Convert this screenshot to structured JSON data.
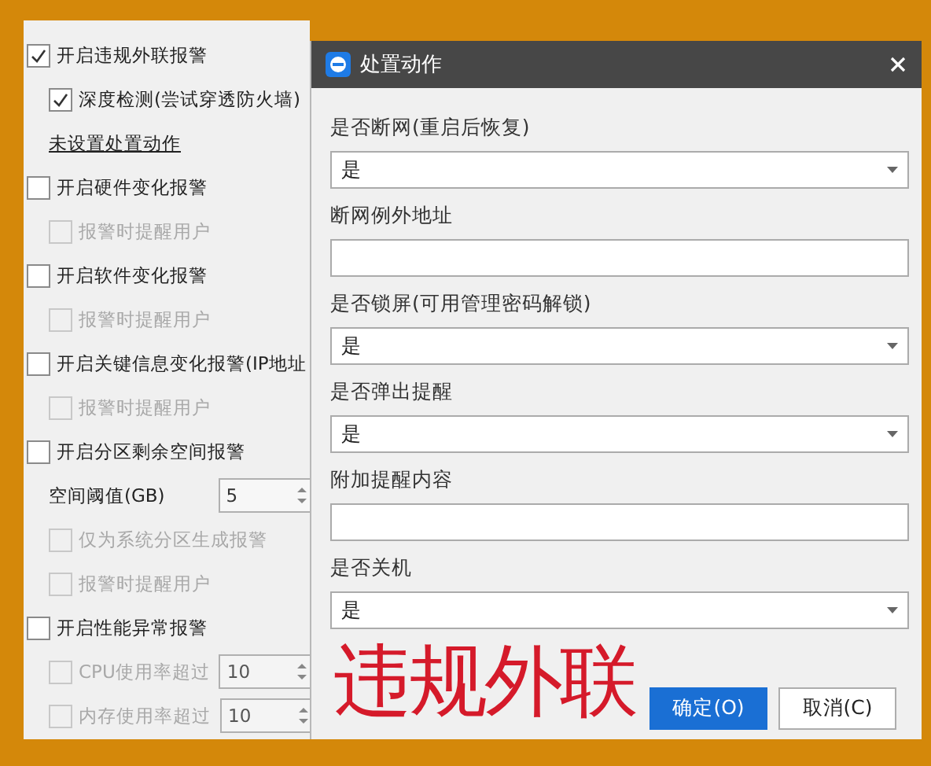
{
  "settings_panel": {
    "items": [
      {
        "kind": "checkbox",
        "label": "开启违规外联报警",
        "checked": true,
        "disabled": false,
        "children": [
          {
            "kind": "checkbox",
            "label": "深度检测(尝试穿透防火墙)",
            "checked": true,
            "disabled": false
          },
          {
            "kind": "link",
            "label": "未设置处置动作"
          }
        ]
      },
      {
        "kind": "checkbox",
        "label": "开启硬件变化报警",
        "checked": false,
        "disabled": false,
        "children": [
          {
            "kind": "checkbox",
            "label": "报警时提醒用户",
            "checked": false,
            "disabled": true
          }
        ]
      },
      {
        "kind": "checkbox",
        "label": "开启软件变化报警",
        "checked": false,
        "disabled": false,
        "children": [
          {
            "kind": "checkbox",
            "label": "报警时提醒用户",
            "checked": false,
            "disabled": true
          }
        ]
      },
      {
        "kind": "checkbox",
        "label": "开启关键信息变化报警(IP地址",
        "checked": false,
        "disabled": false,
        "children": [
          {
            "kind": "checkbox",
            "label": "报警时提醒用户",
            "checked": false,
            "disabled": true
          }
        ]
      },
      {
        "kind": "checkbox",
        "label": "开启分区剩余空间报警",
        "checked": false,
        "disabled": false,
        "children": [
          {
            "kind": "number",
            "label": "空间阈值(GB)",
            "value": "5",
            "disabled": false
          },
          {
            "kind": "checkbox",
            "label": "仅为系统分区生成报警",
            "checked": false,
            "disabled": true
          },
          {
            "kind": "checkbox",
            "label": "报警时提醒用户",
            "checked": false,
            "disabled": true
          }
        ]
      },
      {
        "kind": "checkbox",
        "label": "开启性能异常报警",
        "checked": false,
        "disabled": false,
        "children": [
          {
            "kind": "number",
            "label": "CPU使用率超过",
            "value": "10",
            "disabled": true,
            "checked": false
          },
          {
            "kind": "number",
            "label": "内存使用率超过",
            "value": "10",
            "disabled": true,
            "checked": false
          }
        ]
      }
    ]
  },
  "dialog": {
    "title": "处置动作",
    "fields": [
      {
        "kind": "select",
        "label": "是否断网(重启后恢复)",
        "value": "是"
      },
      {
        "kind": "text",
        "label": "断网例外地址"
      },
      {
        "kind": "select",
        "label": "是否锁屏(可用管理密码解锁)",
        "value": "是"
      },
      {
        "kind": "select",
        "label": "是否弹出提醒",
        "value": "是"
      },
      {
        "kind": "text",
        "label": "附加提醒内容"
      },
      {
        "kind": "select",
        "label": "是否关机",
        "value": "是"
      }
    ],
    "buttons": [
      {
        "label": "确定(O)",
        "kind": "primary"
      },
      {
        "label": "取消(C)",
        "kind": "secondary"
      }
    ]
  },
  "annotation": {
    "text": "违规外联"
  }
}
